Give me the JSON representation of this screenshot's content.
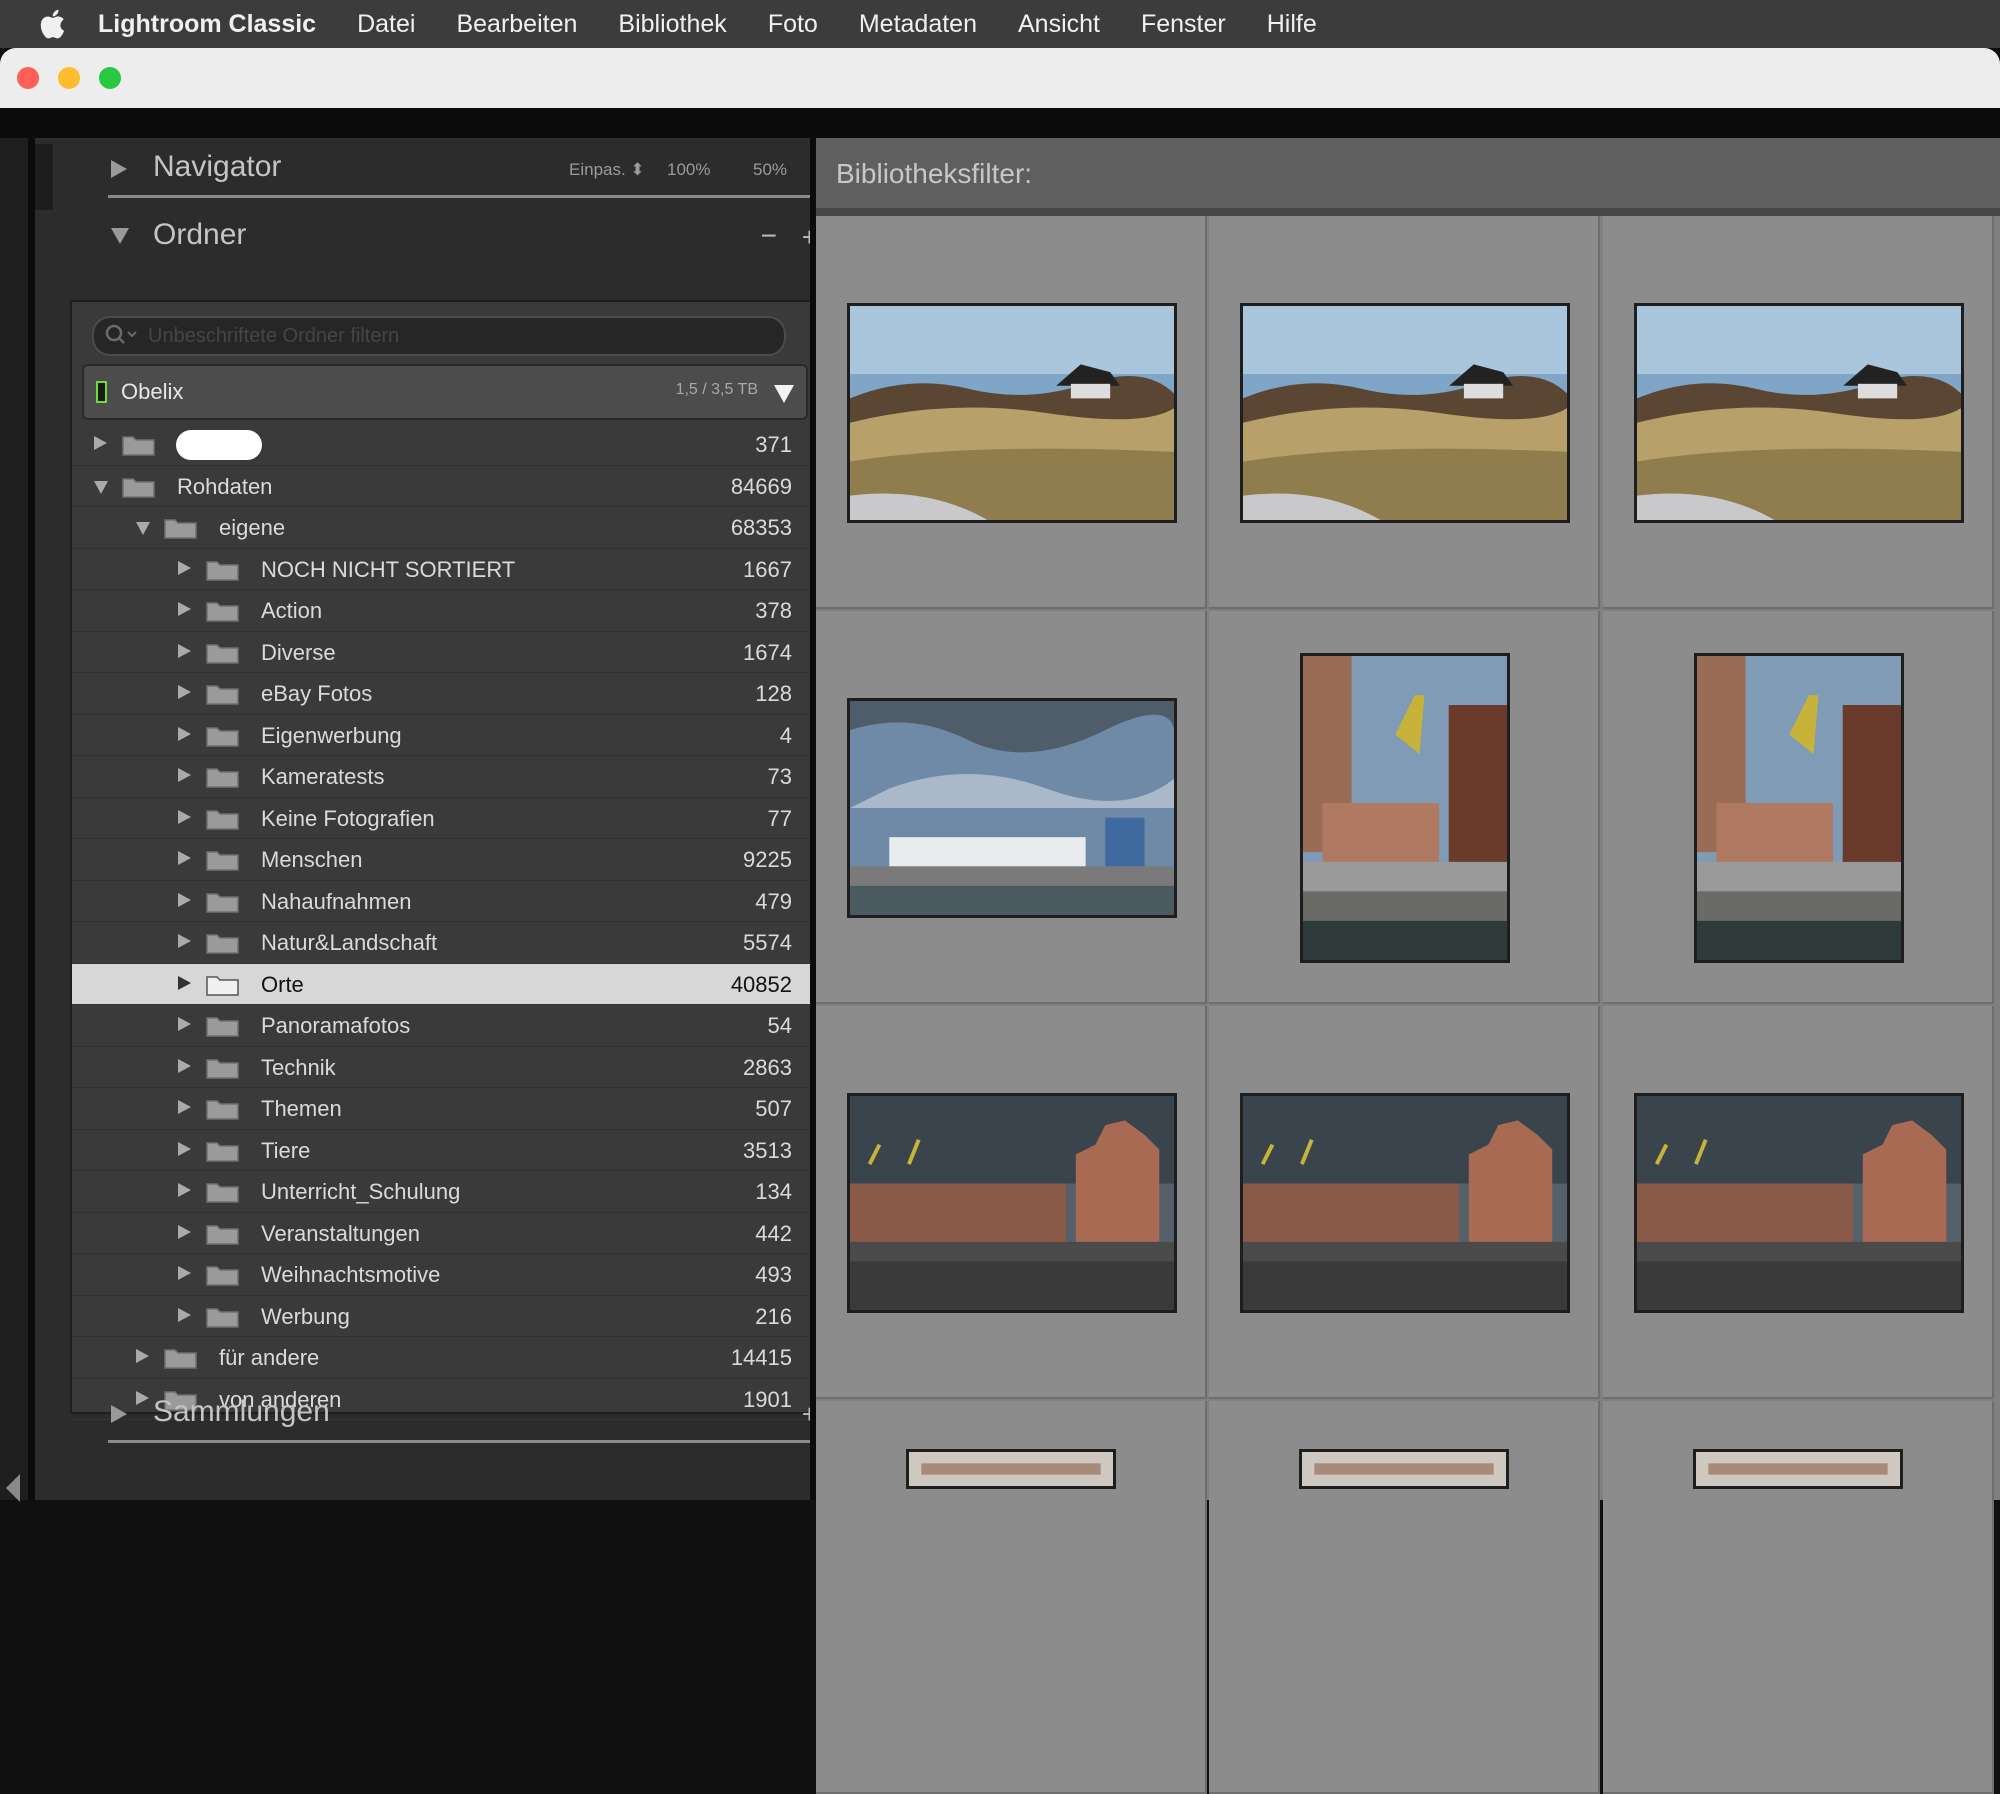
{
  "menubar": {
    "apple_icon": "apple-icon",
    "app_name": "Lightroom Classic",
    "items": [
      "Datei",
      "Bearbeiten",
      "Bibliothek",
      "Foto",
      "Metadaten",
      "Ansicht",
      "Fenster",
      "Hilfe"
    ]
  },
  "window": {
    "controls": [
      "close",
      "minimize",
      "zoom"
    ],
    "colors": {
      "close": "#fe5f57",
      "minimize": "#febc2e",
      "zoom": "#28c840"
    }
  },
  "navigator": {
    "title": "Navigator",
    "zoom_options": [
      "Einpas.",
      "100%",
      "50%"
    ],
    "zoom_selected": "Einpas."
  },
  "folders": {
    "title": "Ordner",
    "search_placeholder": "Unbeschriftete Ordner filtern",
    "volume": {
      "name": "Obelix",
      "size": "1,5 / 3,5 TB",
      "status_color": "#6fdc3c"
    },
    "rows": [
      {
        "name": "",
        "count": "371",
        "level": 0,
        "expanded": false,
        "redacted": true
      },
      {
        "name": "Rohdaten",
        "count": "84669",
        "level": 0,
        "expanded": true
      },
      {
        "name": "eigene",
        "count": "68353",
        "level": 1,
        "expanded": true
      },
      {
        "name": "NOCH NICHT SORTIERT",
        "count": "1667",
        "level": 2
      },
      {
        "name": "Action",
        "count": "378",
        "level": 2
      },
      {
        "name": "Diverse",
        "count": "1674",
        "level": 2
      },
      {
        "name": "eBay Fotos",
        "count": "128",
        "level": 2
      },
      {
        "name": "Eigenwerbung",
        "count": "4",
        "level": 2
      },
      {
        "name": "Kameratests",
        "count": "73",
        "level": 2
      },
      {
        "name": "Keine Fotografien",
        "count": "77",
        "level": 2
      },
      {
        "name": "Menschen",
        "count": "9225",
        "level": 2
      },
      {
        "name": "Nahaufnahmen",
        "count": "479",
        "level": 2
      },
      {
        "name": "Natur&Landschaft",
        "count": "5574",
        "level": 2
      },
      {
        "name": "Orte",
        "count": "40852",
        "level": 2,
        "selected": true
      },
      {
        "name": "Panoramafotos",
        "count": "54",
        "level": 2
      },
      {
        "name": "Technik",
        "count": "2863",
        "level": 2
      },
      {
        "name": "Themen",
        "count": "507",
        "level": 2
      },
      {
        "name": "Tiere",
        "count": "3513",
        "level": 2
      },
      {
        "name": "Unterricht_Schulung",
        "count": "134",
        "level": 2
      },
      {
        "name": "Veranstaltungen",
        "count": "442",
        "level": 2
      },
      {
        "name": "Weihnachtsmotive",
        "count": "493",
        "level": 2
      },
      {
        "name": "Werbung",
        "count": "216",
        "level": 2
      },
      {
        "name": "für andere",
        "count": "14415",
        "level": 1
      },
      {
        "name": "von anderen",
        "count": "1901",
        "level": 1
      }
    ]
  },
  "collections": {
    "title": "Sammlungen"
  },
  "library_filter": {
    "label": "Bibliotheksfilter:"
  },
  "grid": {
    "thumbnails": [
      {
        "scene": "dune"
      },
      {
        "scene": "dune"
      },
      {
        "scene": "dune"
      },
      {
        "scene": "harbor"
      },
      {
        "scene": "warehouse"
      },
      {
        "scene": "warehouse"
      },
      {
        "scene": "gables"
      },
      {
        "scene": "gables"
      },
      {
        "scene": "gables"
      },
      {
        "scene": "partial"
      },
      {
        "scene": "partial"
      },
      {
        "scene": "partial"
      }
    ]
  }
}
